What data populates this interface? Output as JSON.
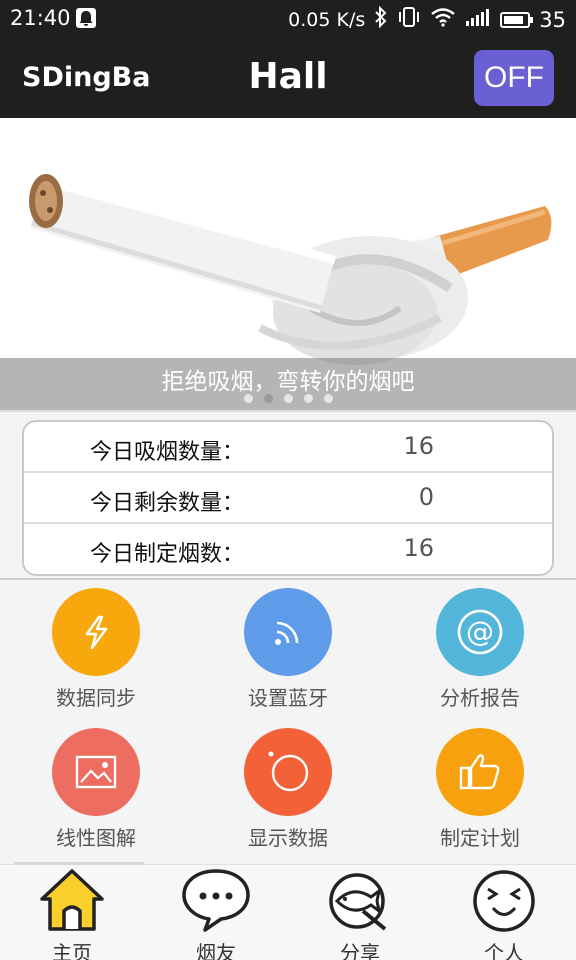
{
  "status_bar": {
    "time": "21:40",
    "net_speed": "0.05 K/s",
    "battery": "35"
  },
  "app_bar": {
    "app_name": "SDingBa",
    "title": "Hall",
    "toggle_label": "OFF",
    "toggle_color": "#6b5fd4"
  },
  "banner": {
    "caption": "拒绝吸烟，弯转你的烟吧",
    "page_count": 5,
    "active_page": 2
  },
  "stats": [
    {
      "label": "今日吸烟数量：",
      "value": "16"
    },
    {
      "label": "今日剩余数量：",
      "value": "0"
    },
    {
      "label": "今日制定烟数：",
      "value": "16"
    }
  ],
  "features": [
    {
      "label": "数据同步",
      "icon": "lightning-icon",
      "color": "#f6a80d"
    },
    {
      "label": "设置蓝牙",
      "icon": "bluetooth-signal-icon",
      "color": "#5e9be8"
    },
    {
      "label": "分析报告",
      "icon": "at-sign-icon",
      "color": "#53b5d9"
    },
    {
      "label": "线性图解",
      "icon": "image-icon",
      "color": "#ed6e60"
    },
    {
      "label": "显示数据",
      "icon": "camera-lens-icon",
      "color": "#f26138"
    },
    {
      "label": "制定计划",
      "icon": "thumbs-up-icon",
      "color": "#f6a10d"
    }
  ],
  "tabs": [
    {
      "label": "主页",
      "icon": "home-icon",
      "active": true
    },
    {
      "label": "烟友",
      "icon": "chat-bubble-icon",
      "active": false
    },
    {
      "label": "分享",
      "icon": "fish-share-icon",
      "active": false
    },
    {
      "label": "个人",
      "icon": "face-icon",
      "active": false
    }
  ]
}
